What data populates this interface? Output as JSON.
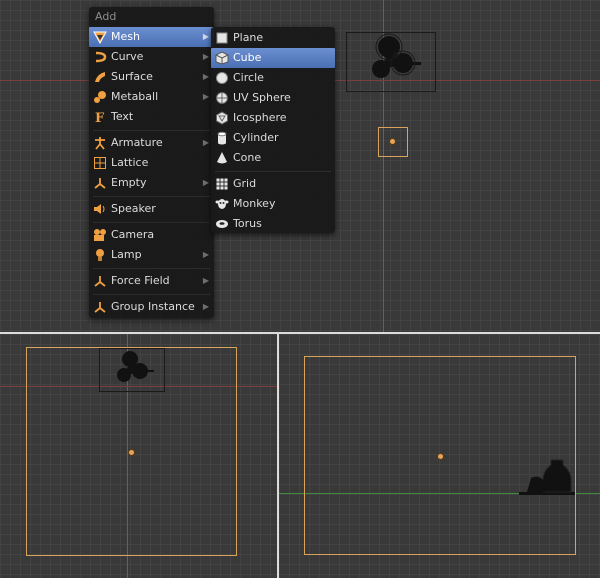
{
  "add_menu": {
    "title": "Add",
    "items": [
      {
        "label": "Mesh",
        "icon": "mesh-icon",
        "submenu": true,
        "active": true
      },
      {
        "label": "Curve",
        "icon": "curve-icon",
        "submenu": true
      },
      {
        "label": "Surface",
        "icon": "surface-icon",
        "submenu": true
      },
      {
        "label": "Metaball",
        "icon": "metaball-icon",
        "submenu": true
      },
      {
        "label": "Text",
        "icon": "text-icon",
        "submenu": false
      },
      {
        "label": "Armature",
        "icon": "armature-icon",
        "submenu": true
      },
      {
        "label": "Lattice",
        "icon": "lattice-icon",
        "submenu": false
      },
      {
        "label": "Empty",
        "icon": "empty-icon",
        "submenu": true
      },
      {
        "label": "Speaker",
        "icon": "speaker-icon",
        "submenu": false
      },
      {
        "label": "Camera",
        "icon": "camera-icon",
        "submenu": false
      },
      {
        "label": "Lamp",
        "icon": "lamp-icon",
        "submenu": true
      },
      {
        "label": "Force Field",
        "icon": "force-field-icon",
        "submenu": true
      },
      {
        "label": "Group Instance",
        "icon": "group-instance-icon",
        "submenu": true
      }
    ]
  },
  "mesh_submenu": {
    "items": [
      {
        "label": "Plane",
        "icon": "plane-icon"
      },
      {
        "label": "Cube",
        "icon": "cube-icon",
        "active": true
      },
      {
        "label": "Circle",
        "icon": "circle-icon"
      },
      {
        "label": "UV Sphere",
        "icon": "uv-sphere-icon"
      },
      {
        "label": "Icosphere",
        "icon": "icosphere-icon"
      },
      {
        "label": "Cylinder",
        "icon": "cylinder-icon"
      },
      {
        "label": "Cone",
        "icon": "cone-icon"
      },
      {
        "label": "Grid",
        "icon": "grid-icon"
      },
      {
        "label": "Monkey",
        "icon": "monkey-icon"
      },
      {
        "label": "Torus",
        "icon": "torus-icon"
      }
    ]
  },
  "colors": {
    "background": "#393939",
    "highlight": "#5680c2",
    "selection_outline": "#d8a35a",
    "x_axis": "#7a3f3f",
    "y_axis": "#3f8a3f"
  }
}
